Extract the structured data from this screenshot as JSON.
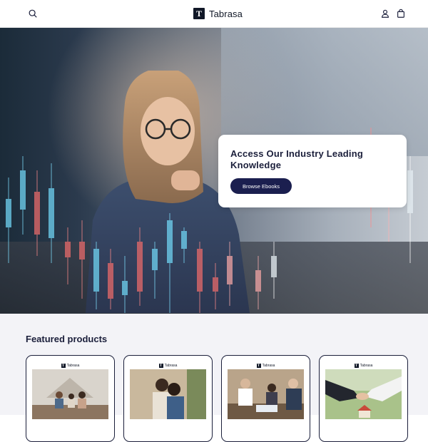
{
  "header": {
    "brand": "Tabrasa",
    "logo_letter": "T",
    "icons": [
      "search-icon",
      "account-icon",
      "cart-icon"
    ]
  },
  "hero": {
    "title": "Access Our Industry Leading Knowledge",
    "button_label": "Browse Ebooks"
  },
  "featured": {
    "title": "Featured products",
    "products": [
      {
        "brand": "Tabrasa",
        "logo_letter": "T"
      },
      {
        "brand": "Tabrasa",
        "logo_letter": "T"
      },
      {
        "brand": "Tabrasa",
        "logo_letter": "T"
      },
      {
        "brand": "Tabrasa",
        "logo_letter": "T"
      }
    ]
  },
  "colors": {
    "primary": "#1b1f4f",
    "text": "#1b1f3b",
    "featured_bg": "#f3f3f7"
  }
}
